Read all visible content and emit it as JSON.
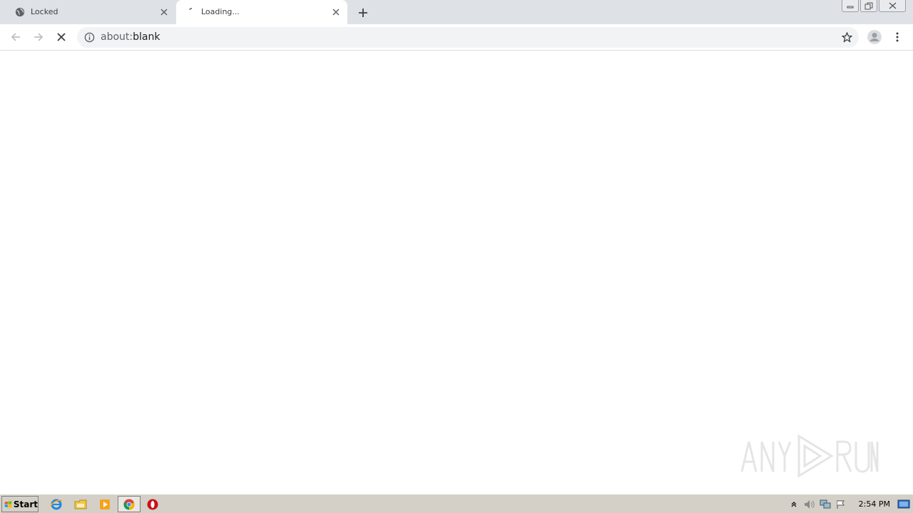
{
  "browser": {
    "tabs": [
      {
        "title": "Locked",
        "favicon": "globe-icon",
        "active": false
      },
      {
        "title": "Loading...",
        "favicon": "loading-spinner-icon",
        "active": true
      }
    ],
    "address": {
      "scheme": "about:",
      "path": "blank",
      "icon": "info-icon"
    },
    "accent": "#5f6368",
    "tabstrip_color": "#dee1e6",
    "omnibox_color": "#f1f3f4"
  },
  "taskbar": {
    "start_label": "Start",
    "quick_launch": [
      "internet-explorer-icon",
      "file-explorer-icon",
      "media-player-icon",
      "chrome-icon",
      "opera-icon"
    ],
    "tray_icons": [
      "show-hidden-icons-icon",
      "volume-icon",
      "network-icon",
      "action-center-flag-icon",
      "show-desktop-icon"
    ],
    "clock": "2:54 PM",
    "color": "#d4d0c8"
  }
}
